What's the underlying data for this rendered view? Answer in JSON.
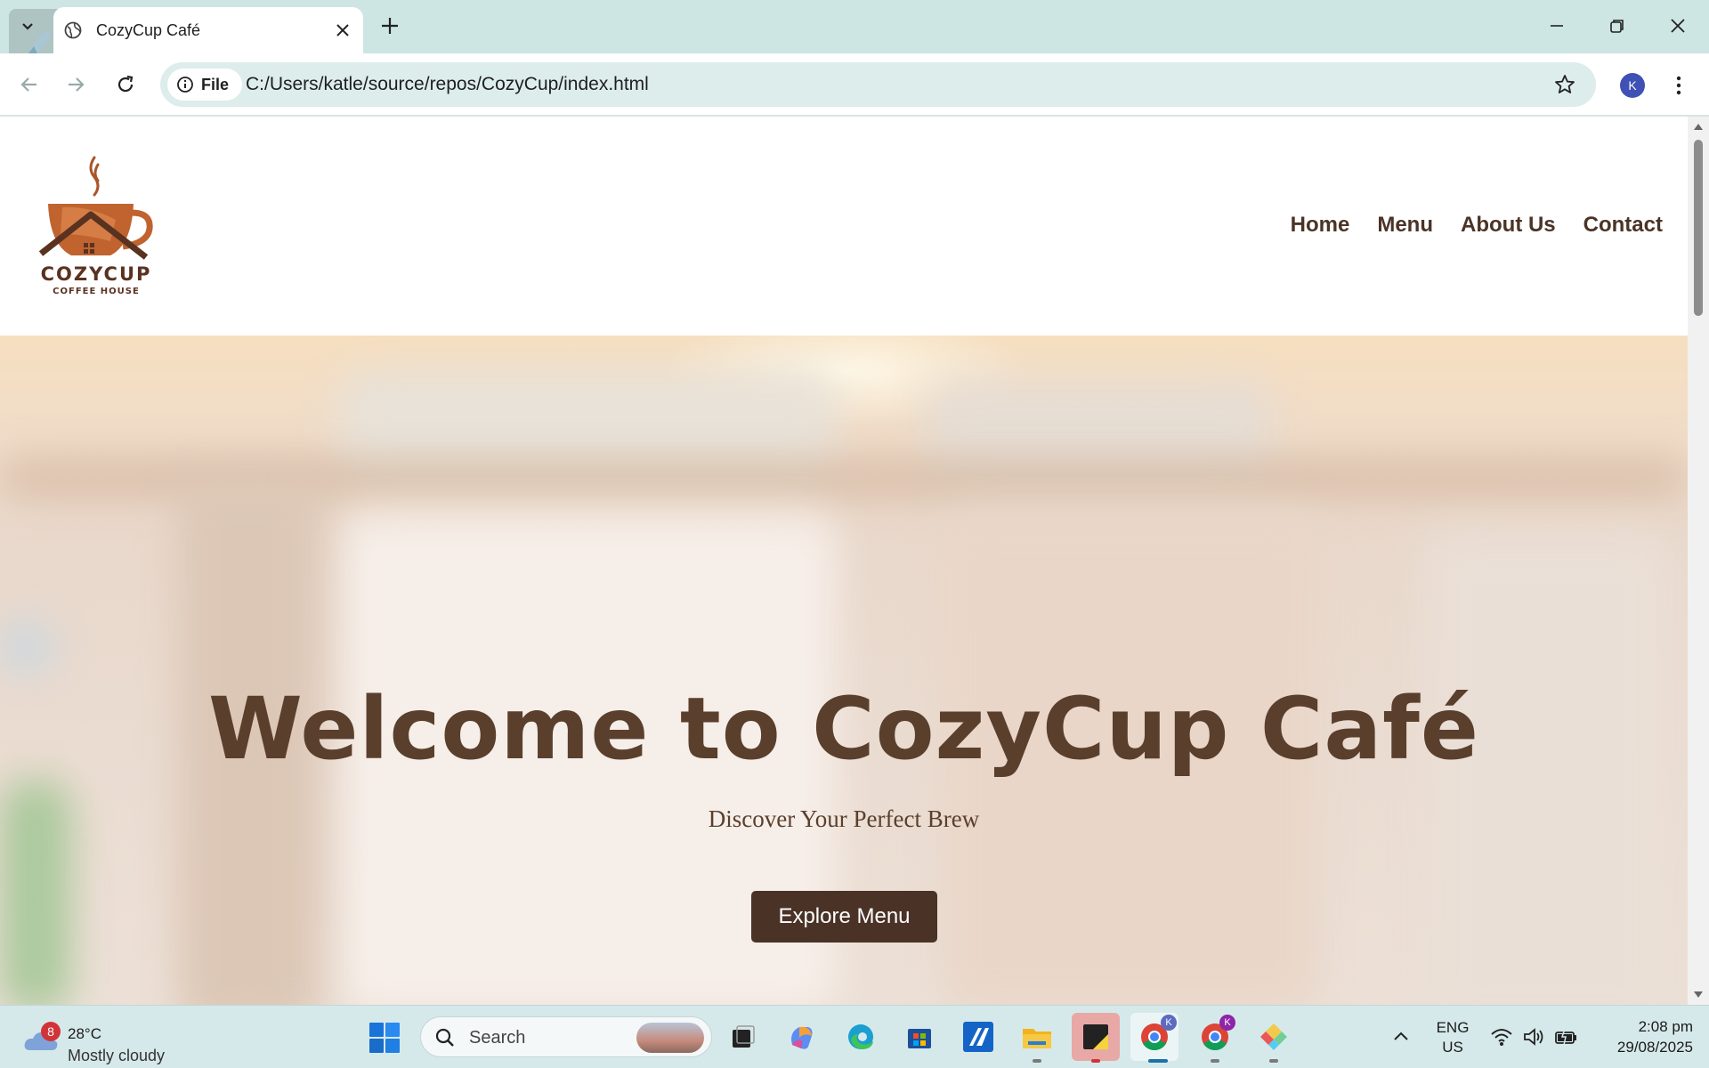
{
  "browser": {
    "tab_title": "CozyCup Café",
    "site_chip_label": "File",
    "url": "C:/Users/katle/source/repos/CozyCup/index.html",
    "profile_initial": "K"
  },
  "site": {
    "logo_text": "COZYCUP",
    "logo_subtext": "COFFEE HOUSE",
    "nav": [
      "Home",
      "Menu",
      "About Us",
      "Contact"
    ],
    "hero_title": "Welcome to CozyCup Café",
    "hero_subtitle": "Discover Your Perfect Brew",
    "cta_label": "Explore Menu",
    "colors": {
      "brand_brown": "#4a3226",
      "heading_brown": "#5a3f2d",
      "logo_orange": "#c0632f"
    }
  },
  "taskbar": {
    "weather_badge": "8",
    "temperature": "28°C",
    "weather_condition": "Mostly cloudy",
    "search_label": "Search",
    "lang_line1": "ENG",
    "lang_line2": "US",
    "time": "2:08 pm",
    "date": "29/08/2025",
    "chrome_badge": "K"
  }
}
